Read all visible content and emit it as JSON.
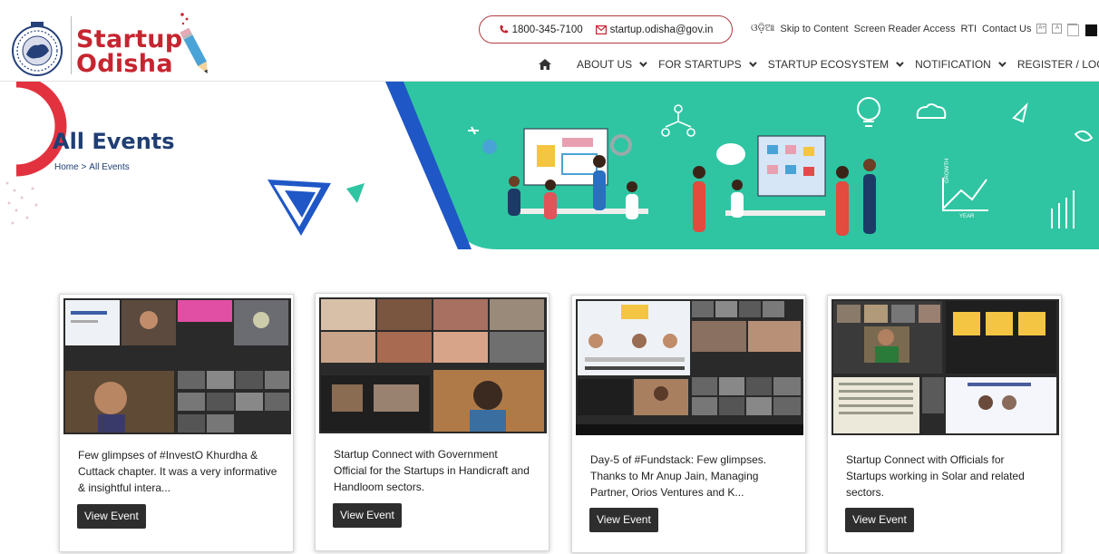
{
  "header": {
    "brand_line1": "Startup",
    "brand_line2": "Odisha",
    "phone": "1800-345-7100",
    "email": "startup.odisha@gov.in",
    "odia_label": "ଓଡ଼ିଆ",
    "skip_to_content": "Skip to Content",
    "screen_reader": "Screen Reader Access",
    "rti": "RTI",
    "contact_us": "Contact Us",
    "font_sizes": [
      "A+",
      "A",
      "A-"
    ]
  },
  "nav": {
    "items": [
      "ABOUT US",
      "FOR STARTUPS",
      "STARTUP ECOSYSTEM",
      "NOTIFICATION"
    ],
    "register": "REGISTER / LOGIN"
  },
  "banner": {
    "title": "All Events",
    "breadcrumb_home": "Home >",
    "breadcrumb_current": "All Events",
    "chart_axis": "GROWTH",
    "chart_label": "YEAR"
  },
  "events": [
    {
      "description": "Few glimpses of #InvestO Khurdha & Cuttack chapter. It was a very informative & insightful intera...",
      "button": "View Event"
    },
    {
      "description": "Startup Connect with Government Official for the Startups in Handicraft and Handloom sectors.",
      "button": "View Event"
    },
    {
      "description": "Day-5 of #Fundstack: Few glimpses. Thanks to Mr Anup Jain, Managing Partner, Orios Ventures and K...",
      "button": "View Event"
    },
    {
      "description": "Startup Connect with Officials for Startups working in Solar and related sectors.",
      "button": "View Event"
    }
  ],
  "colors": {
    "brand_red": "#c62530",
    "navy": "#1f3e74",
    "teal": "#2fc5a2",
    "blue_accent": "#1f57c7",
    "button_dark": "#2e2e2e"
  }
}
